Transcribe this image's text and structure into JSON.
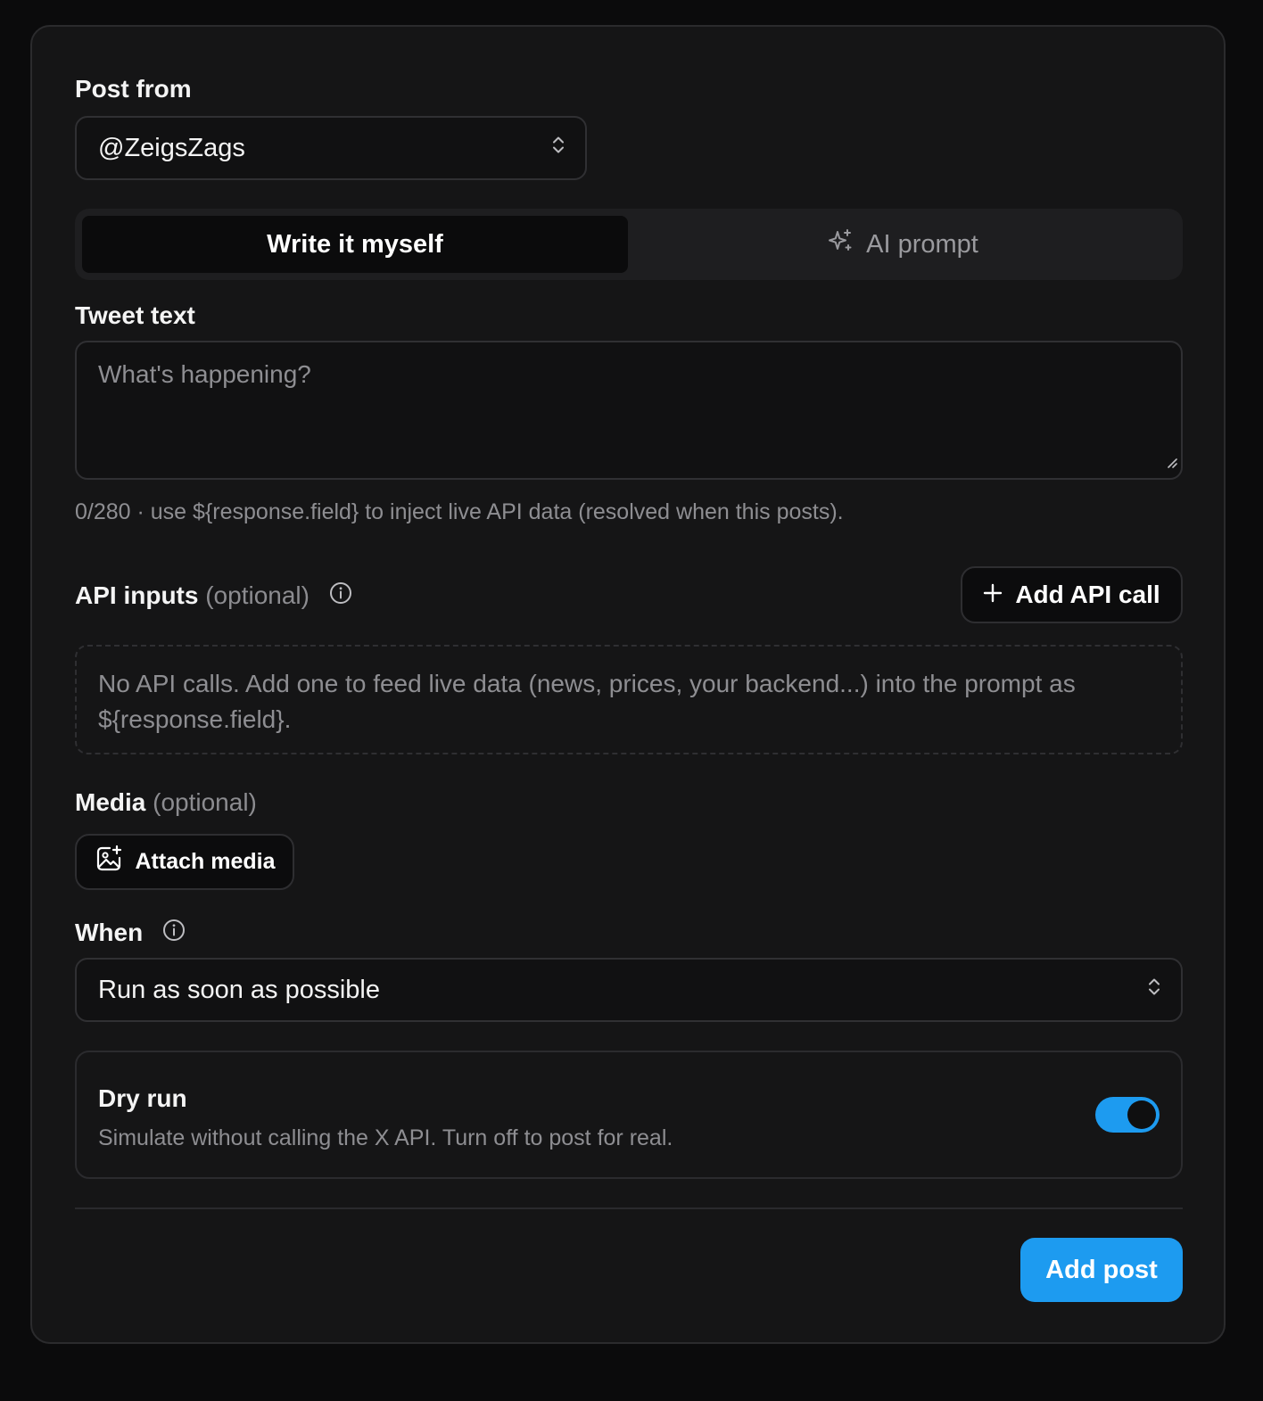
{
  "form": {
    "post_from": {
      "label": "Post from",
      "selected": "@ZeigsZags"
    },
    "mode_tabs": [
      {
        "label": "Write it myself",
        "active": true
      },
      {
        "label": "AI prompt",
        "active": false,
        "icon": "sparkles-icon"
      }
    ],
    "tweet": {
      "label": "Tweet text",
      "placeholder": "What's happening?",
      "value": "",
      "hint": "0/280 · use ${response.field} to inject live API data (resolved when this posts)."
    },
    "api_inputs": {
      "label": "API inputs",
      "optional": "(optional)",
      "add_button": "Add API call",
      "empty_text": "No API calls. Add one to feed live data (news, prices, your backend...) into the prompt as ${response.field}."
    },
    "media": {
      "label": "Media",
      "optional": "(optional)",
      "attach_button": "Attach media"
    },
    "when": {
      "label": "When",
      "selected": "Run as soon as possible"
    },
    "dry_run": {
      "title": "Dry run",
      "description": "Simulate without calling the X API. Turn off to post for real.",
      "enabled": true
    },
    "submit_label": "Add post"
  },
  "colors": {
    "accent": "#1d9bf0",
    "card_bg": "#151516",
    "page_bg": "#0b0b0c",
    "muted_text": "#8e8e92"
  }
}
